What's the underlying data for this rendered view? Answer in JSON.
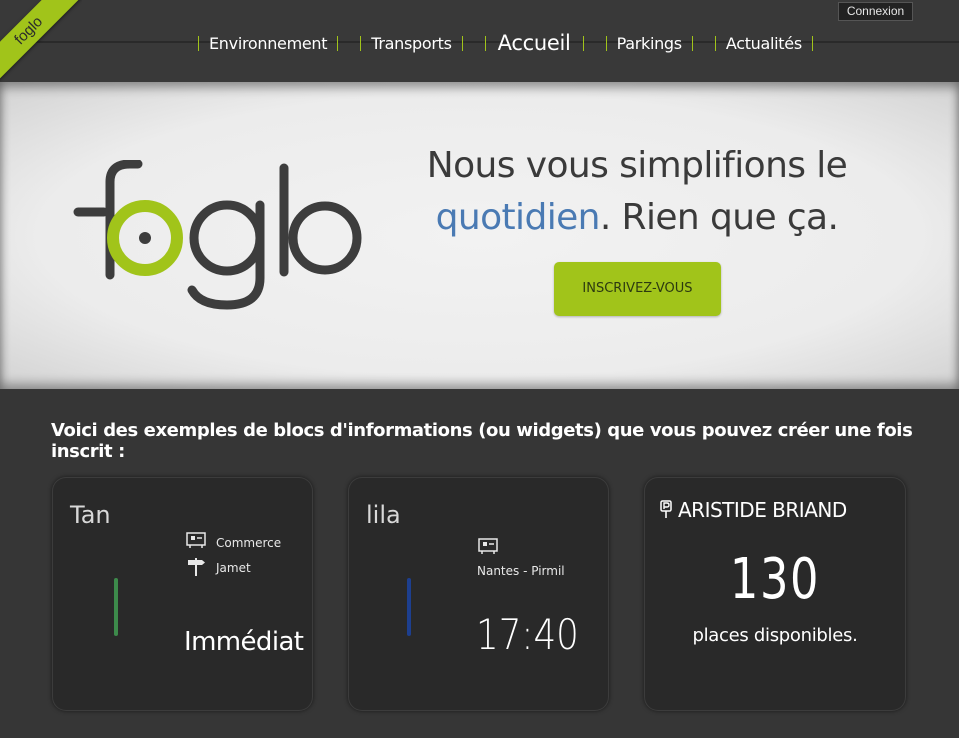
{
  "header": {
    "ribbon_label": "foglo",
    "login_label": "Connexion",
    "nav": [
      {
        "label": "Environnement",
        "active": false
      },
      {
        "label": "Transports",
        "active": false
      },
      {
        "label": "Accueil",
        "active": true
      },
      {
        "label": "Parkings",
        "active": false
      },
      {
        "label": "Actualités",
        "active": false
      }
    ]
  },
  "hero": {
    "logo_text": "foglo",
    "tagline_part1": "Nous vous simplifions le",
    "tagline_highlight": "quotidien",
    "tagline_part2": ". Rien que ça.",
    "signup_label": "INSCRIVEZ-VOUS"
  },
  "examples": {
    "title": "Voici des exemples de blocs d'informations (ou widgets) que vous pouvez créer une fois inscrit :",
    "tan": {
      "title": "Tan",
      "stop": "Commerce",
      "direction": "Jamet",
      "time": "Immédiat",
      "line_color": "#3d8a4b"
    },
    "lila": {
      "title": "lila",
      "destination": "Nantes - Pirmil",
      "time": "17:40",
      "line_color": "#1d3f8f"
    },
    "parking": {
      "name": "ARISTIDE BRIAND",
      "count": "130",
      "subtitle": "places disponibles."
    }
  },
  "colors": {
    "accent": "#a1c41a",
    "highlight": "#4a7ab3",
    "background": "#363636"
  },
  "icons": {
    "stop": "bus-stop-icon",
    "direction": "signpost-icon",
    "parking": "parking-sign-icon"
  }
}
